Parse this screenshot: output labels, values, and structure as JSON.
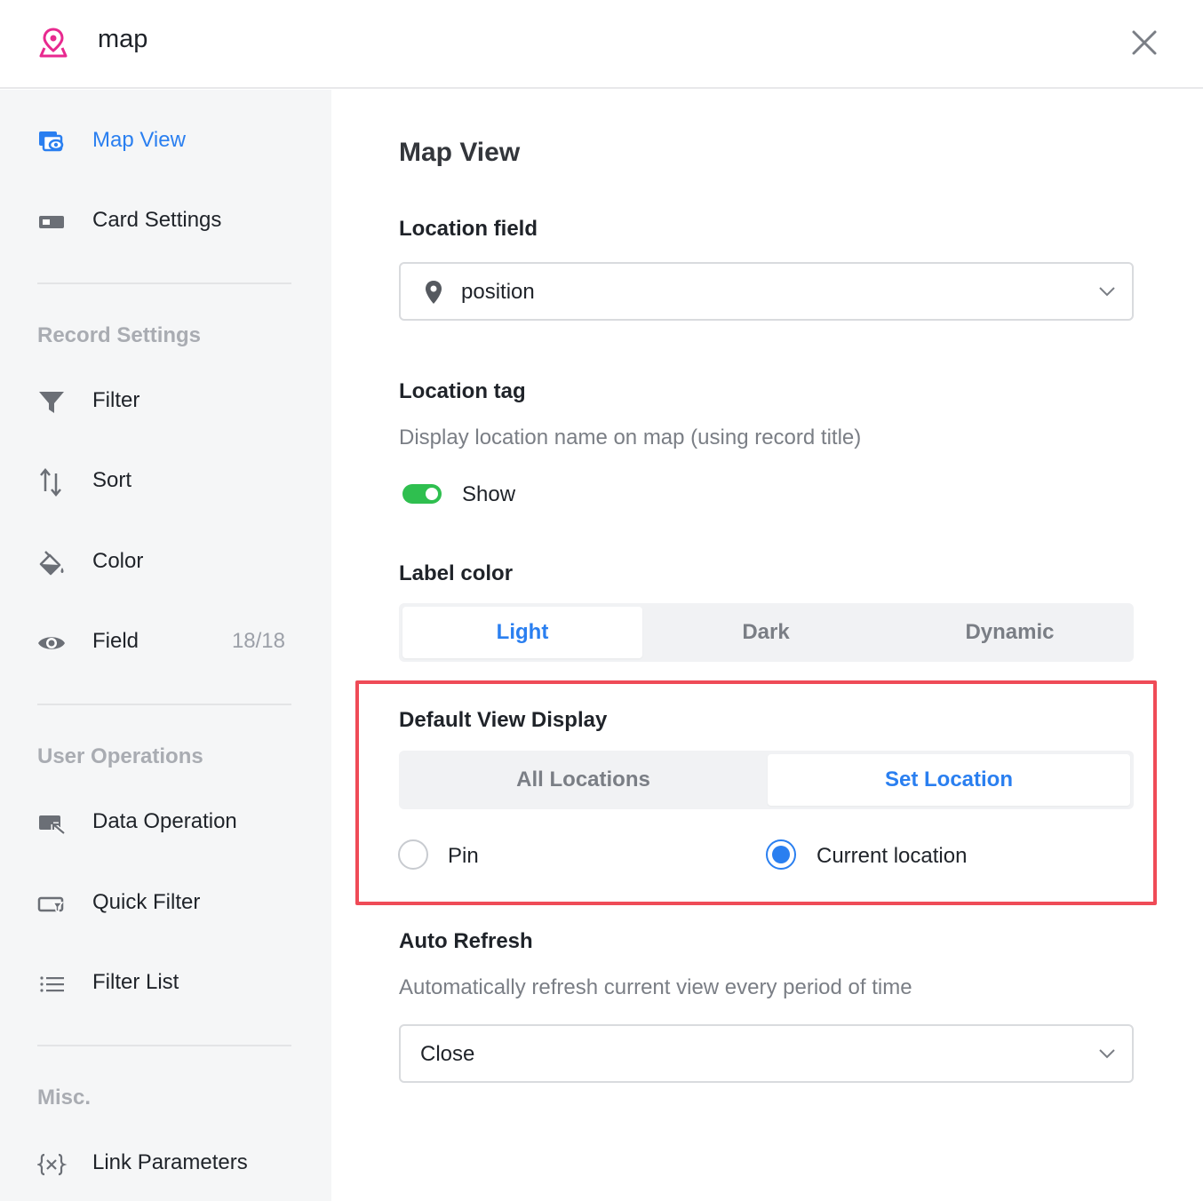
{
  "header": {
    "app_icon": "map-pin-icon",
    "title": "map",
    "close_icon": "close-icon"
  },
  "sidebar": {
    "items_top": [
      {
        "label": "Map View",
        "icon": "map-view-icon",
        "active": true
      },
      {
        "label": "Card Settings",
        "icon": "card-icon"
      }
    ],
    "record_settings": {
      "title": "Record Settings",
      "items": [
        {
          "label": "Filter",
          "icon": "filter-icon"
        },
        {
          "label": "Sort",
          "icon": "sort-icon"
        },
        {
          "label": "Color",
          "icon": "paint-bucket-icon"
        },
        {
          "label": "Field",
          "icon": "eye-icon",
          "count": "18/18"
        }
      ]
    },
    "user_operations": {
      "title": "User Operations",
      "items": [
        {
          "label": "Data Operation",
          "icon": "data-operation-icon"
        },
        {
          "label": "Quick Filter",
          "icon": "quick-filter-icon"
        },
        {
          "label": "Filter List",
          "icon": "list-icon"
        }
      ]
    },
    "misc": {
      "title": "Misc.",
      "items": [
        {
          "label": "Link Parameters",
          "icon": "variable-braces-icon"
        }
      ]
    }
  },
  "main": {
    "title": "Map View",
    "location_field": {
      "label": "Location field",
      "value": "position",
      "icon": "location-pin-icon"
    },
    "location_tag": {
      "label": "Location tag",
      "description": "Display location name on map (using record title)",
      "toggle_label": "Show",
      "toggle_on": true
    },
    "label_color": {
      "label": "Label color",
      "options": [
        "Light",
        "Dark",
        "Dynamic"
      ],
      "selected": "Light"
    },
    "default_view_display": {
      "label": "Default View Display",
      "options": [
        "All Locations",
        "Set Location"
      ],
      "selected": "Set Location",
      "radios": [
        {
          "label": "Pin",
          "checked": false
        },
        {
          "label": "Current location",
          "checked": true
        }
      ]
    },
    "auto_refresh": {
      "label": "Auto Refresh",
      "description": "Automatically refresh current view every period of time",
      "value": "Close"
    }
  },
  "colors": {
    "accent": "#2a7ff0",
    "toggle_on": "#2fbf4f",
    "highlight": "#ef4b57",
    "brand_icon": "#e8298f"
  }
}
